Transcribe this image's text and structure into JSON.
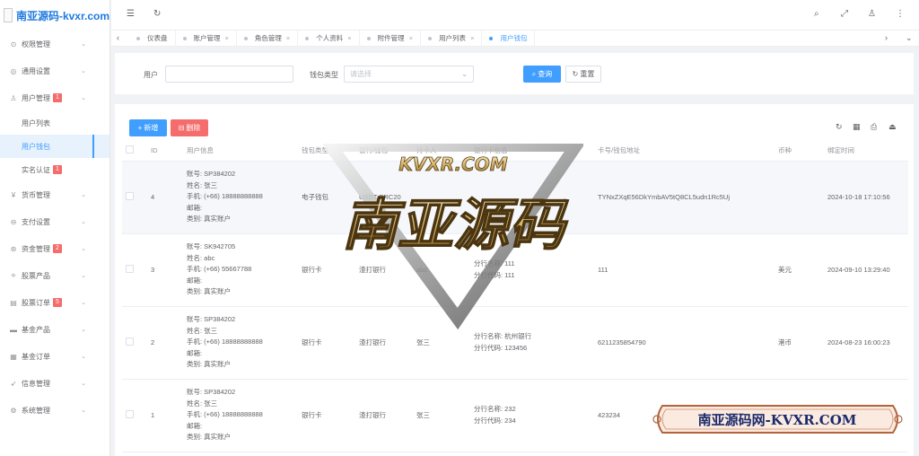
{
  "app": {
    "logo_text": "南亚源码-kvxr.com"
  },
  "sidebar": {
    "items": [
      {
        "label": "权限管理",
        "icon": "shield-icon",
        "glyph": "⊙",
        "chevron": true
      },
      {
        "label": "通用设置",
        "icon": "settings-icon",
        "glyph": "◎",
        "chevron": true
      },
      {
        "label": "用户管理",
        "icon": "user-icon",
        "glyph": "♙",
        "chevron": true,
        "badge": "1"
      },
      {
        "label": "用户列表",
        "sub": true
      },
      {
        "label": "用户钱包",
        "sub": true,
        "active": true
      },
      {
        "label": "实名认证",
        "sub": true,
        "badge": "1"
      },
      {
        "label": "货币管理",
        "icon": "currency-icon",
        "glyph": "¥",
        "chevron": true
      },
      {
        "label": "支付设置",
        "icon": "payment-icon",
        "glyph": "⊖",
        "chevron": true
      },
      {
        "label": "资金管理",
        "icon": "fund-icon",
        "glyph": "⊛",
        "chevron": true,
        "badge": "2"
      },
      {
        "label": "股票产品",
        "icon": "stock-icon",
        "glyph": "⟡",
        "chevron": true
      },
      {
        "label": "股票订单",
        "icon": "order-icon",
        "glyph": "▤",
        "chevron": true,
        "badge": "5"
      },
      {
        "label": "基金产品",
        "icon": "fund-product-icon",
        "glyph": "▬",
        "chevron": true
      },
      {
        "label": "基金订单",
        "icon": "fund-order-icon",
        "glyph": "▦",
        "chevron": true
      },
      {
        "label": "信息管理",
        "icon": "message-icon",
        "glyph": "➶",
        "chevron": true
      },
      {
        "label": "系统管理",
        "icon": "system-icon",
        "glyph": "⚙",
        "chevron": true
      }
    ]
  },
  "tabs": [
    {
      "label": "仪表盘",
      "closable": false
    },
    {
      "label": "账户管理",
      "closable": true
    },
    {
      "label": "角色管理",
      "closable": true
    },
    {
      "label": "个人资料",
      "closable": true
    },
    {
      "label": "附件管理",
      "closable": true
    },
    {
      "label": "用户列表",
      "closable": true
    },
    {
      "label": "用户钱包",
      "closable": false,
      "active": true
    }
  ],
  "search": {
    "user_label": "用户",
    "user_value": "",
    "wallet_type_label": "钱包类型",
    "wallet_type_placeholder": "请选择",
    "query_label": "查询",
    "reset_label": "重置"
  },
  "toolbar": {
    "add_label": "新增",
    "delete_label": "删除"
  },
  "table": {
    "headers": [
      "ID",
      "用户信息",
      "钱包类型",
      "银行/钱包",
      "持卡人",
      "银行卡信息",
      "卡号/钱包地址",
      "币种",
      "绑定时间"
    ],
    "rows": [
      {
        "id": "4",
        "info": [
          "账号: SP384202",
          "姓名: 张三",
          "手机: (+66) 18888888888",
          "邮箱:",
          "类别: 真实账户"
        ],
        "wallet_type": "电子钱包",
        "bank": "USDT-ERC20",
        "holder": "",
        "card_info": [],
        "address": "TYNxZXqE56DkYmbAV5tQ8CL5udn1Rc5Uj",
        "currency": "",
        "time": "2024-10-18 17:10:56",
        "highlight": true
      },
      {
        "id": "3",
        "info": [
          "账号: SK942705",
          "姓名: abc",
          "手机: (+66) 55667788",
          "邮箱:",
          "类别: 真实账户"
        ],
        "wallet_type": "银行卡",
        "bank": "渣打银行",
        "holder": "abc",
        "card_info": [
          "分行名称: 111",
          "分行代码: 111"
        ],
        "address": "111",
        "currency": "美元",
        "time": "2024-09-10 13:29:40",
        "highlight": false
      },
      {
        "id": "2",
        "info": [
          "账号: SP384202",
          "姓名: 张三",
          "手机: (+66) 18888888888",
          "邮箱:",
          "类别: 真实账户"
        ],
        "wallet_type": "银行卡",
        "bank": "渣打银行",
        "holder": "张三",
        "card_info": [
          "分行名称: 杭州银行",
          "分行代码: 123456"
        ],
        "address": "6211235854790",
        "currency": "港币",
        "time": "2024-08-23 16:00:23",
        "highlight": false
      },
      {
        "id": "1",
        "info": [
          "账号: SP384202",
          "姓名: 张三",
          "手机: (+66) 18888888888",
          "邮箱:",
          "类别: 真实账户"
        ],
        "wallet_type": "银行卡",
        "bank": "渣打银行",
        "holder": "张三",
        "card_info": [
          "分行名称: 232",
          "分行代码: 234"
        ],
        "address": "423234",
        "currency": "",
        "time": "",
        "highlight": false
      }
    ]
  },
  "watermark": {
    "top_text": "KVXR.COM",
    "main_text": "南亚源码",
    "banner_text": "南亚源码网-KVXR.COM"
  },
  "colors": {
    "primary": "#409eff",
    "danger": "#f56c6c",
    "badge": "#f56c6c",
    "logo": "#1f7ae0"
  }
}
